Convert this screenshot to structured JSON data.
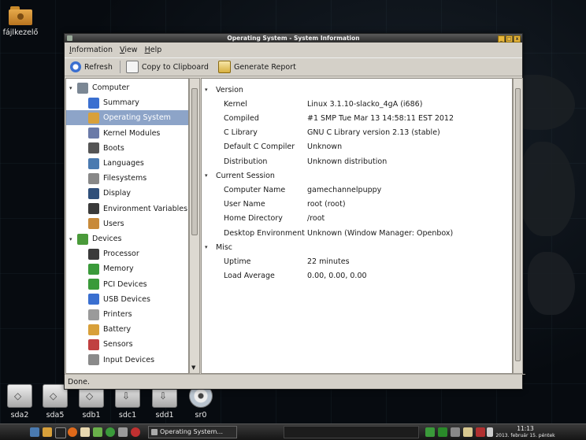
{
  "desktop": {
    "icon_label": "fájlkezelő",
    "drives": [
      {
        "label": "sda2",
        "type": "hdd"
      },
      {
        "label": "sda5",
        "type": "hdd"
      },
      {
        "label": "sdb1",
        "type": "hdd"
      },
      {
        "label": "sdc1",
        "type": "usb"
      },
      {
        "label": "sdd1",
        "type": "usb"
      },
      {
        "label": "sr0",
        "type": "cd"
      }
    ]
  },
  "window": {
    "title": "Operating System - System Information",
    "menu": [
      "Information",
      "View",
      "Help"
    ],
    "toolbar": {
      "refresh": "Refresh",
      "copy": "Copy to Clipboard",
      "report": "Generate Report"
    },
    "tree": [
      {
        "label": "Computer",
        "level": 0,
        "expander": "▾",
        "icon": "computer-icon",
        "color": "#7b8794"
      },
      {
        "label": "Summary",
        "level": 1,
        "icon": "info-icon",
        "color": "#3a6fd0"
      },
      {
        "label": "Operating System",
        "level": 1,
        "icon": "os-icon",
        "color": "#d8a03a",
        "selected": true
      },
      {
        "label": "Kernel Modules",
        "level": 1,
        "icon": "module-icon",
        "color": "#6a7aa8"
      },
      {
        "label": "Boots",
        "level": 1,
        "icon": "power-icon",
        "color": "#555555"
      },
      {
        "label": "Languages",
        "level": 1,
        "icon": "language-icon",
        "color": "#4a7ab0"
      },
      {
        "label": "Filesystems",
        "level": 1,
        "icon": "filesystem-icon",
        "color": "#888888"
      },
      {
        "label": "Display",
        "level": 1,
        "icon": "display-icon",
        "color": "#2f4f7a"
      },
      {
        "label": "Environment Variables",
        "level": 1,
        "icon": "env-icon",
        "color": "#3a3a3a"
      },
      {
        "label": "Users",
        "level": 1,
        "icon": "users-icon",
        "color": "#c88a3a"
      },
      {
        "label": "Devices",
        "level": 0,
        "expander": "▾",
        "icon": "devices-icon",
        "color": "#4a9a3a"
      },
      {
        "label": "Processor",
        "level": 1,
        "icon": "processor-icon",
        "color": "#3a3a3a"
      },
      {
        "label": "Memory",
        "level": 1,
        "icon": "memory-icon",
        "color": "#3a9a3a"
      },
      {
        "label": "PCI Devices",
        "level": 1,
        "icon": "pci-icon",
        "color": "#3a9a3a"
      },
      {
        "label": "USB Devices",
        "level": 1,
        "icon": "usb-icon",
        "color": "#3a6fd0"
      },
      {
        "label": "Printers",
        "level": 1,
        "icon": "printer-icon",
        "color": "#9a9a9a"
      },
      {
        "label": "Battery",
        "level": 1,
        "icon": "battery-icon",
        "color": "#d8a03a"
      },
      {
        "label": "Sensors",
        "level": 1,
        "icon": "sensor-icon",
        "color": "#c04040"
      },
      {
        "label": "Input Devices",
        "level": 1,
        "icon": "input-icon",
        "color": "#8a8a8a"
      }
    ],
    "sections": [
      {
        "title": "Version",
        "rows": [
          {
            "key": "Kernel",
            "value": "Linux 3.1.10-slacko_4gA (i686)"
          },
          {
            "key": "Compiled",
            "value": "#1 SMP Tue Mar 13 14:58:11 EST 2012"
          },
          {
            "key": "C Library",
            "value": "GNU C Library version 2.13 (stable)"
          },
          {
            "key": "Default C Compiler",
            "value": "Unknown"
          },
          {
            "key": "Distribution",
            "value": "Unknown distribution"
          }
        ]
      },
      {
        "title": "Current Session",
        "rows": [
          {
            "key": "Computer Name",
            "value": "gamechannelpuppy"
          },
          {
            "key": "User Name",
            "value": "root (root)"
          },
          {
            "key": "Home Directory",
            "value": "/root"
          },
          {
            "key": "Desktop Environment",
            "value": "Unknown (Window Manager: Openbox)"
          }
        ]
      },
      {
        "title": "Misc",
        "rows": [
          {
            "key": "Uptime",
            "value": "22 minutes"
          },
          {
            "key": "Load Average",
            "value": "0.00, 0.00, 0.00"
          }
        ]
      }
    ],
    "status": "Done."
  },
  "taskbar": {
    "task_label": "Operating System...",
    "time": "11:13",
    "date": "2013. február 15. péntek"
  }
}
